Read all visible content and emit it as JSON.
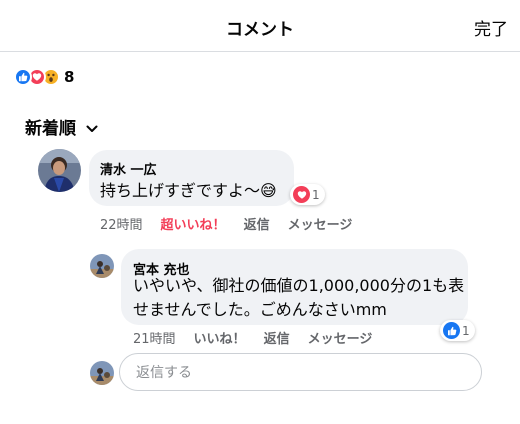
{
  "header": {
    "title": "コメント",
    "done_label": "完了"
  },
  "reactions": {
    "icons": [
      "like-icon",
      "love-icon",
      "wow-icon"
    ],
    "count": "8"
  },
  "sort": {
    "label": "新着順"
  },
  "comments": [
    {
      "author": "清水 一広",
      "text": "持ち上げすぎですよ〜😅",
      "reaction_icon": "love-icon",
      "reaction_count": "1",
      "time": "22時間",
      "reaction_label": "超いいね！",
      "reply_label": "返信",
      "message_label": "メッセージ"
    },
    {
      "author": "宮本 充也",
      "text_lines": [
        "いやいや、御社の価値の1,000,000分の1も表",
        "せませんでした。ごめんなさいmm"
      ],
      "reaction_icon": "like-icon",
      "reaction_count": "1",
      "time": "21時間",
      "reaction_label": "いいね！",
      "reply_label": "返信",
      "message_label": "メッセージ"
    }
  ],
  "reply_box": {
    "placeholder": "返信する"
  },
  "colors": {
    "like": "#1877f2",
    "love": "#f33e58",
    "wow": "#f7b125",
    "bubble": "#f0f2f5",
    "meta": "#65676b"
  }
}
